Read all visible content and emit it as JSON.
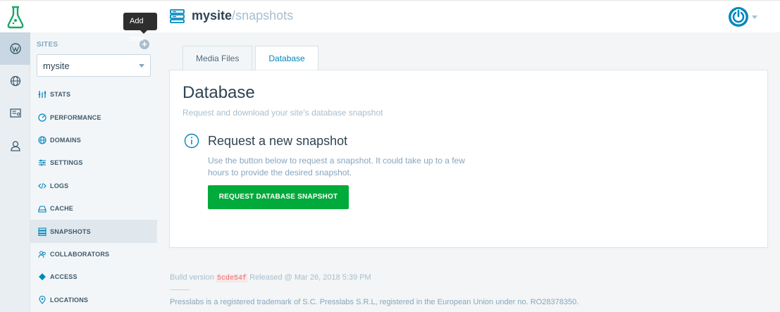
{
  "header": {
    "site": "mysite",
    "separator": "/",
    "page": "snapshots"
  },
  "tooltip": "Add new",
  "sidebar": {
    "sites_label": "SITES",
    "add_label": "+",
    "selected_site": "mysite",
    "items": [
      {
        "label": "STATS",
        "icon": "stats-icon"
      },
      {
        "label": "PERFORMANCE",
        "icon": "gauge-icon"
      },
      {
        "label": "DOMAINS",
        "icon": "globe-icon"
      },
      {
        "label": "SETTINGS",
        "icon": "sliders-icon"
      },
      {
        "label": "LOGS",
        "icon": "code-icon"
      },
      {
        "label": "CACHE",
        "icon": "drive-icon"
      },
      {
        "label": "SNAPSHOTS",
        "icon": "server-icon"
      },
      {
        "label": "COLLABORATORS",
        "icon": "people-icon"
      },
      {
        "label": "ACCESS",
        "icon": "diamond-icon"
      },
      {
        "label": "LOCATIONS",
        "icon": "pin-icon"
      }
    ]
  },
  "tabs": [
    {
      "label": "Media Files"
    },
    {
      "label": "Database"
    }
  ],
  "card": {
    "title": "Database",
    "subtitle": "Request and download your site's database snapshot",
    "section_title": "Request a new snapshot",
    "description": "Use the button below to request a snapshot. It could take up to a few hours to provide the desired snapshot.",
    "button": "REQUEST DATABASE SNAPSHOT"
  },
  "footer": {
    "build_prefix": "Build version",
    "build_hash": "5cde54f",
    "build_suffix": "Released @ Mar 26, 2018 5:39 PM",
    "legal": "Presslabs is a registered trademark of S.C. Presslabs S.R.L, registered in the European Union under no. RO28378350."
  },
  "colors": {
    "accent": "#0087be",
    "button_green": "#00aa3b",
    "logo_green": "#1aa76a",
    "sidebar_bg": "#f3f6f8"
  }
}
